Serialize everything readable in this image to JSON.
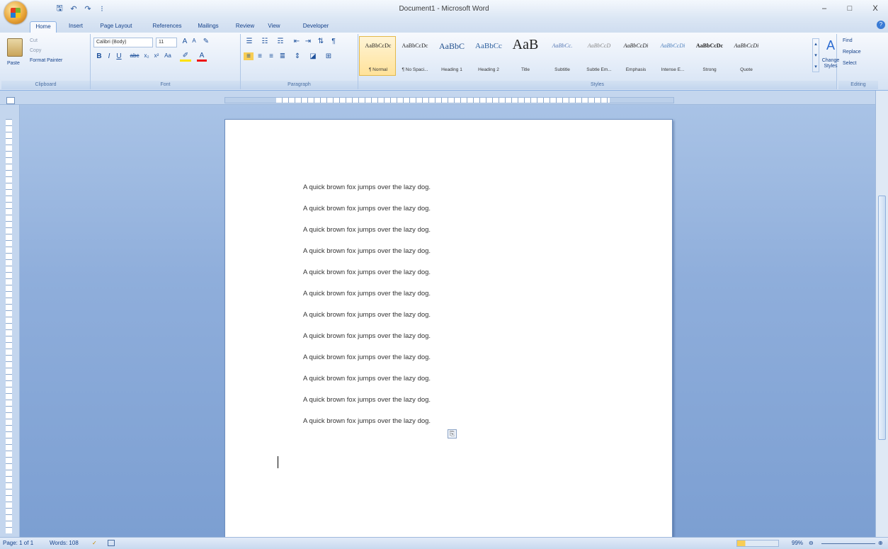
{
  "window": {
    "title": "Document1 - Microsoft Word",
    "minimize": "–",
    "maximize": "□",
    "close": "X"
  },
  "qat": {
    "save": "🖫",
    "undo": "↶",
    "redo": "↷",
    "more": "⁝"
  },
  "tabs": [
    "Home",
    "Insert",
    "Page Layout",
    "References",
    "Mailings",
    "Review",
    "View",
    "Developer"
  ],
  "clipboard": {
    "label": "Clipboard",
    "paste": "Paste",
    "cut": "Cut",
    "copy": "Copy",
    "format_painter": "Format Painter"
  },
  "font": {
    "label": "Font",
    "name": "Calibri (Body)",
    "size": "11"
  },
  "paragraph": {
    "label": "Paragraph"
  },
  "styles": {
    "label": "Styles",
    "items": [
      {
        "sample": "AaBbCcDc",
        "name": "¶ Normal"
      },
      {
        "sample": "AaBbCcDc",
        "name": "¶ No Spaci..."
      },
      {
        "sample": "AaBbC",
        "name": "Heading 1"
      },
      {
        "sample": "AaBbCc",
        "name": "Heading 2"
      },
      {
        "sample": "AaB",
        "name": "Title"
      },
      {
        "sample": "AaBbCc.",
        "name": "Subtitle"
      },
      {
        "sample": "AaBbCcD",
        "name": "Subtle Em..."
      },
      {
        "sample": "AaBbCcDi",
        "name": "Emphasis"
      },
      {
        "sample": "AaBbCcDi",
        "name": "Intense E..."
      },
      {
        "sample": "AaBbCcDc",
        "name": "Strong"
      },
      {
        "sample": "AaBbCcDi",
        "name": "Quote"
      }
    ],
    "change_styles": "Change Styles"
  },
  "editing": {
    "label": "Editing",
    "find": "Find",
    "replace": "Replace",
    "select": "Select"
  },
  "document": {
    "lines": [
      "A quick brown fox jumps over the lazy dog.",
      "A quick brown fox jumps over the lazy dog.",
      "A quick brown fox jumps over the lazy dog.",
      "A quick brown fox jumps over the lazy dog.",
      "A quick brown fox jumps over the lazy dog.",
      "A quick brown fox jumps over the lazy dog.",
      "A quick brown fox jumps over the lazy dog.",
      "A quick brown fox jumps over the lazy dog.",
      "A quick brown fox jumps over the lazy dog.",
      "A quick brown fox jumps over the lazy dog.",
      "A quick brown fox jumps over the lazy dog.",
      "A quick brown fox jumps over the lazy dog."
    ]
  },
  "status": {
    "page": "Page: 1 of 1",
    "words": "Words: 108",
    "zoom": "99%"
  }
}
